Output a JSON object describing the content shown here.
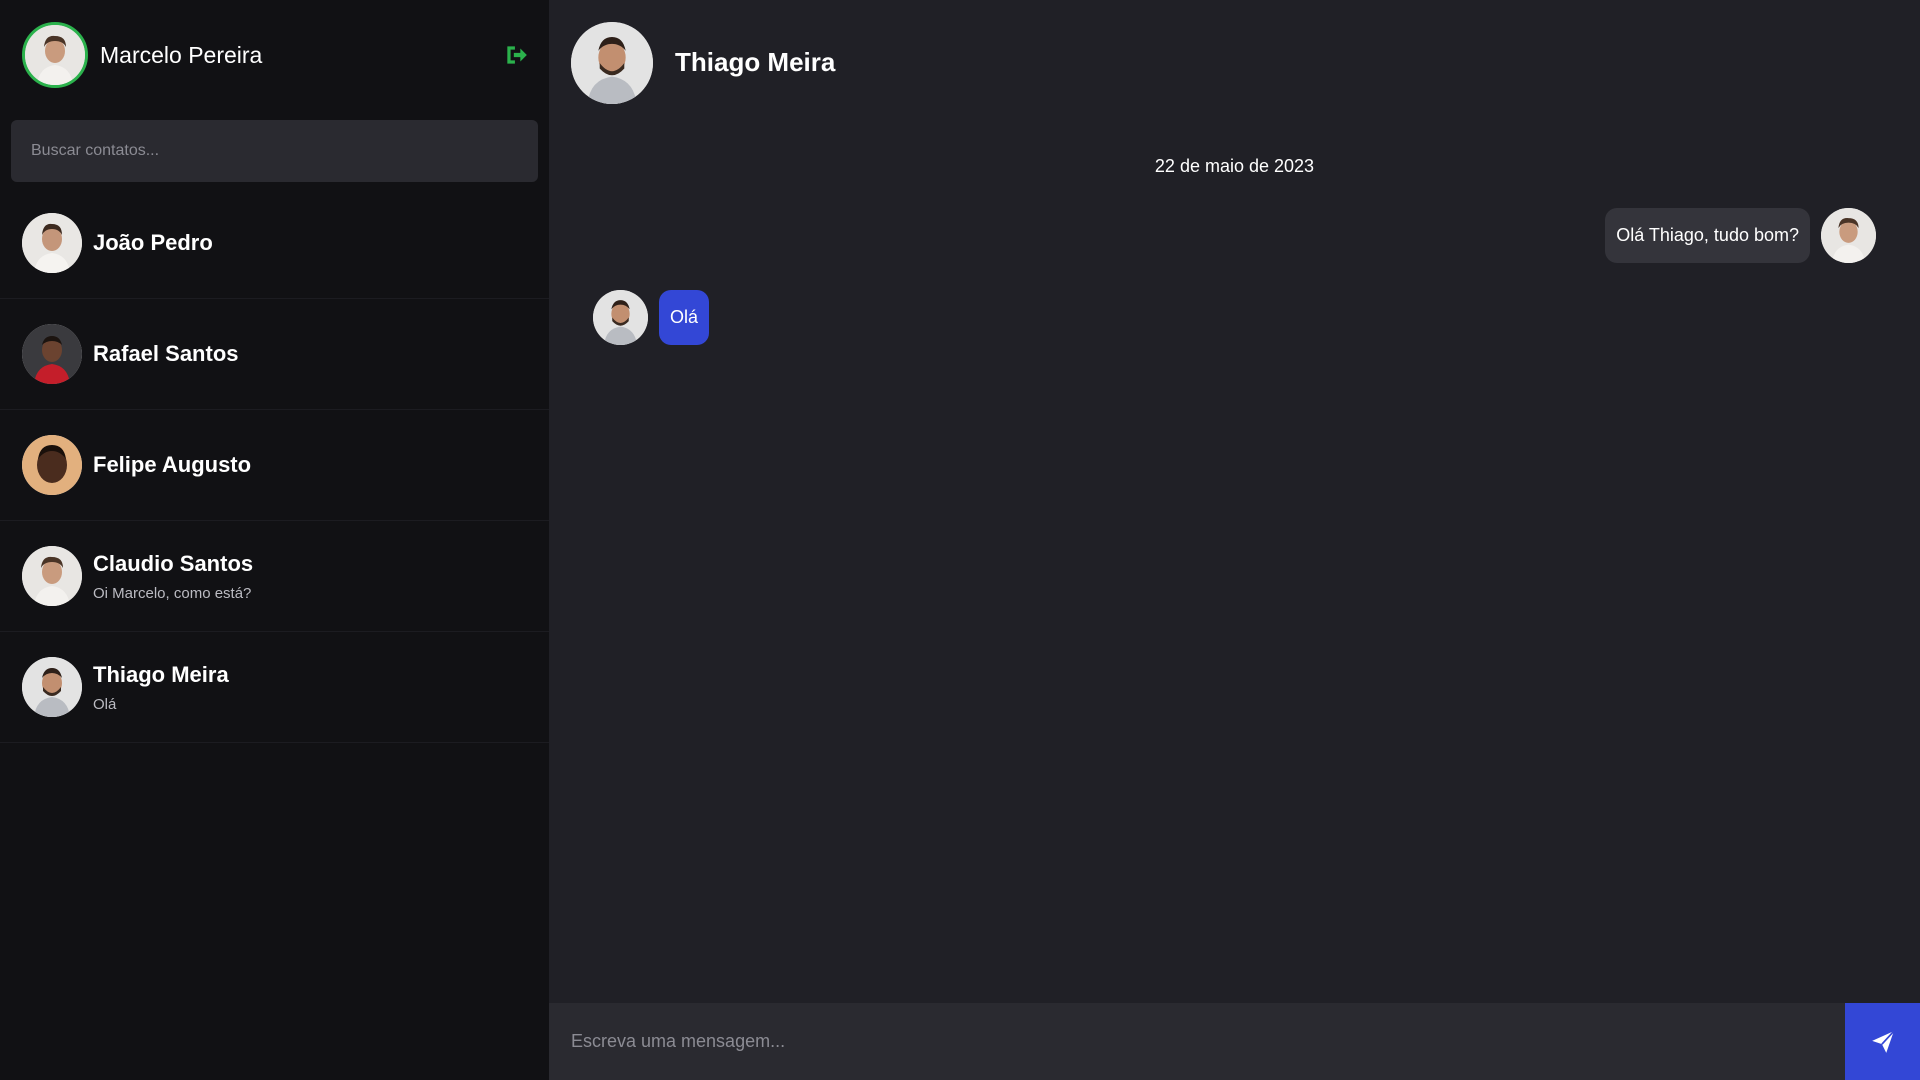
{
  "current_user": {
    "name": "Marcelo Pereira",
    "avatar_icon": "user-avatar-icon"
  },
  "colors": {
    "accent_green": "#2bb24c",
    "accent_blue": "#3347d6",
    "sidebar_bg": "#111114",
    "chat_bg": "#202026"
  },
  "search": {
    "placeholder": "Buscar contatos..."
  },
  "contacts": [
    {
      "name": "João Pedro",
      "last_message": ""
    },
    {
      "name": "Rafael Santos",
      "last_message": ""
    },
    {
      "name": "Felipe Augusto",
      "last_message": ""
    },
    {
      "name": "Claudio Santos",
      "last_message": "Oi Marcelo, como está?"
    },
    {
      "name": "Thiago Meira",
      "last_message": "Olá"
    }
  ],
  "chat": {
    "title": "Thiago Meira",
    "date": "22 de maio de 2023",
    "messages": [
      {
        "direction": "out",
        "text": "Olá Thiago, tudo bom?"
      },
      {
        "direction": "in",
        "text": "Olá"
      }
    ],
    "composer_placeholder": "Escreva uma mensagem..."
  }
}
